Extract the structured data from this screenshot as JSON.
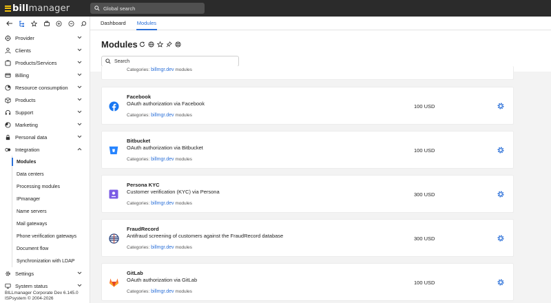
{
  "app": {
    "logo_prefix": "bill",
    "logo_suffix": "manager",
    "global_search_placeholder": "Global search"
  },
  "sidebar": {
    "menu": [
      {
        "label": "Provider",
        "icon": "provider-icon",
        "expanded": false
      },
      {
        "label": "Clients",
        "icon": "clients-icon",
        "expanded": false
      },
      {
        "label": "Products/Services",
        "icon": "products-services-icon",
        "expanded": false
      },
      {
        "label": "Billing",
        "icon": "billing-icon",
        "expanded": false
      },
      {
        "label": "Resource consumption",
        "icon": "resource-consumption-icon",
        "expanded": false
      },
      {
        "label": "Products",
        "icon": "products-icon",
        "expanded": false
      },
      {
        "label": "Support",
        "icon": "support-icon",
        "expanded": false
      },
      {
        "label": "Marketing",
        "icon": "marketing-icon",
        "expanded": false
      },
      {
        "label": "Personal data",
        "icon": "personal-data-icon",
        "expanded": false
      },
      {
        "label": "Integration",
        "icon": "integration-icon",
        "expanded": true
      }
    ],
    "integration_sub": [
      {
        "label": "Modules",
        "active": true
      },
      {
        "label": "Data centers",
        "active": false
      },
      {
        "label": "Processing modules",
        "active": false
      },
      {
        "label": "IPmanager",
        "active": false
      },
      {
        "label": "Name servers",
        "active": false
      },
      {
        "label": "Mail gateways",
        "active": false
      },
      {
        "label": "Phone verification gateways",
        "active": false
      },
      {
        "label": "Document flow",
        "active": false
      },
      {
        "label": "Synchronization with LDAP",
        "active": false
      }
    ],
    "menu_bottom": [
      {
        "label": "Settings",
        "icon": "settings-icon"
      },
      {
        "label": "System status",
        "icon": "system-status-icon"
      }
    ],
    "footer_line1": "BILLmanager Corporate Dev 6.145.0",
    "footer_line2": "ISPsystem © 2004-2026"
  },
  "tabs": [
    {
      "label": "Dashboard",
      "active": false
    },
    {
      "label": "Modules",
      "active": true
    }
  ],
  "page": {
    "title": "Modules",
    "search_placeholder": "Search"
  },
  "partial_card": {
    "categories_label": "Categories:",
    "category_link": "billmgr.dev",
    "category_suffix": "modules"
  },
  "modules": [
    {
      "name": "Facebook",
      "description": "OAuth authorization via Facebook",
      "price": "100 USD",
      "icon": "facebook-icon",
      "categories_label": "Categories:",
      "category_link": "billmgr.dev",
      "category_suffix": "modules"
    },
    {
      "name": "Bitbucket",
      "description": "OAuth authorization via Bitbucket",
      "price": "100 USD",
      "icon": "bitbucket-icon",
      "categories_label": "Categories:",
      "category_link": "billmgr.dev",
      "category_suffix": "modules"
    },
    {
      "name": "Persona KYC",
      "description": "Customer verification (KYC) via Persona",
      "price": "300 USD",
      "icon": "persona-icon",
      "categories_label": "Categories:",
      "category_link": "billmgr.dev",
      "category_suffix": "modules"
    },
    {
      "name": "FraudRecord",
      "description": "Antifraud screening of customers against the FraudRecord database",
      "price": "300 USD",
      "icon": "fraudrecord-icon",
      "categories_label": "Categories:",
      "category_link": "billmgr.dev",
      "category_suffix": "modules"
    },
    {
      "name": "GitLab",
      "description": "OAuth authorization via GitLab",
      "price": "100 USD",
      "icon": "gitlab-icon",
      "categories_label": "Categories:",
      "category_link": "billmgr.dev",
      "category_suffix": "modules"
    }
  ],
  "colors": {
    "accent": "#2a6fd8",
    "topbar": "#2b2b2b",
    "logo_mark": "#f4c20d",
    "facebook": "#1877f2",
    "bitbucket": "#2684ff",
    "persona": "#7b5ce5",
    "gitlab": "#e24329"
  }
}
